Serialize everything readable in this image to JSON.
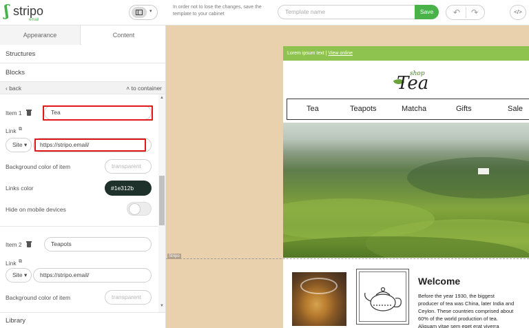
{
  "app": {
    "logo_text": "stripo",
    "logo_sub": "email",
    "hint": "In order not to lose the changes, save the template to your cabinet",
    "template_placeholder": "Template name",
    "save_label": "Save",
    "undo_icon": "undo-icon",
    "redo_icon": "redo-icon",
    "code_icon": "code-icon",
    "code_label": "</>"
  },
  "panel": {
    "tabs": [
      "Appearance",
      "Content"
    ],
    "active_tab": "Content",
    "sections": {
      "structures": "Structures",
      "blocks": "Blocks",
      "library": "Library"
    },
    "back_label": "back",
    "to_container_label": "to container",
    "items": [
      {
        "label": "Item 1",
        "value": "Tea",
        "link_label": "Link",
        "link_type": "Site",
        "link_url": "https://stripo.email/",
        "bg_label": "Background color of item",
        "bg_value": "transparent",
        "links_color_label": "Links color",
        "links_color_value": "#1e312b",
        "hide_label": "Hide on mobile devices",
        "hide_on_mobile": false
      },
      {
        "label": "Item 2",
        "value": "Teapots",
        "link_label": "Link",
        "link_type": "Site",
        "link_url": "https://stripo.email/",
        "bg_label": "Background color of item",
        "bg_value": "transparent"
      }
    ]
  },
  "email": {
    "preheader_text": "Lorem ipsum text | ",
    "view_online": "View online",
    "logo_shop": "shop",
    "logo_tea": "Tea",
    "nav": [
      "Tea",
      "Teapots",
      "Matcha",
      "Gifts",
      "Sale"
    ],
    "block_tag": "Stripo",
    "welcome_title": "Welcome",
    "welcome_body": "Before the year 1930, the biggest\nproducer of tea was China, later India and\nCeylon. These countries comprised about\n60% of the world production of tea.\nAliquam vitae sem eget erat viverra"
  },
  "colors": {
    "brand_green": "#49b34a",
    "preheader_green": "#8fc34f",
    "canvas_bg": "#ead1ae",
    "highlight_red": "#e01818",
    "links_color": "#1e312b"
  }
}
